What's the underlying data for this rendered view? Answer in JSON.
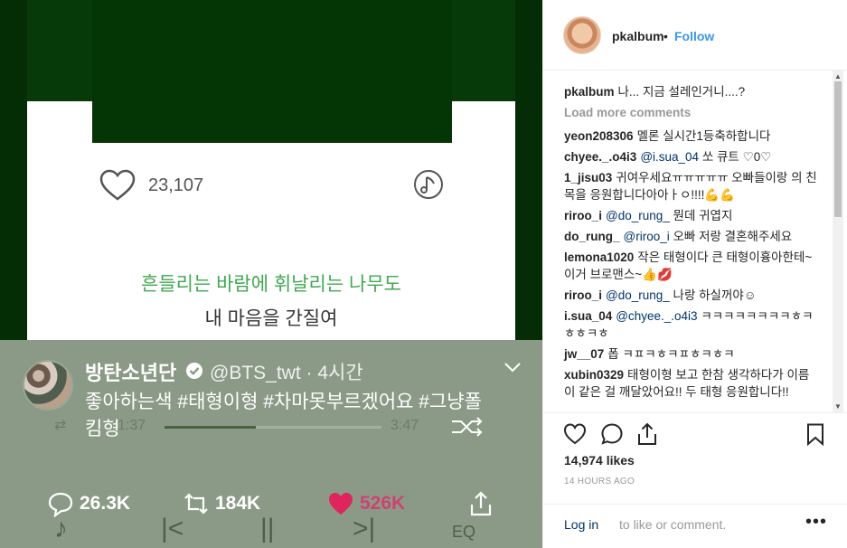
{
  "media": {
    "song": {
      "like_count": "23,107"
    },
    "lyrics": {
      "line1": "흔들리는 바람에 휘날리는 나무도",
      "line2": "내 마음을 간질여"
    },
    "tweet": {
      "name": "방탄소년단",
      "handle_time": "@BTS_twt · 4시간",
      "text_line1": "좋아하는색 #태형이형 #차마못부르겠어요 #그냥폴",
      "text_line2": "킴형",
      "time_start": "1:37",
      "time_end": "3:47",
      "progress_fraction": 0.42,
      "replies": "26.3K",
      "retweets": "184K",
      "likes": "526K",
      "like_color": "#e0245e"
    }
  },
  "post": {
    "username": "pkalbum",
    "separator": "•",
    "follow_label": "Follow",
    "caption": {
      "user": "pkalbum",
      "text": "나... 지금 설레인거니....?"
    },
    "load_more": "Load more comments",
    "comments": [
      {
        "user": "yeon208306",
        "mention": "",
        "text": "멜론 실시간1등축하합니다"
      },
      {
        "user": "chyee._.o4i3",
        "mention": "@i.sua_04",
        "text": "쏘 큐트 ♡0♡"
      },
      {
        "user": "1_jisu03",
        "mention": "",
        "text": "귀여우세요ㅠㅠㅠㅠㅠ 오빠들이랑 의 친목을 응원합니다아아ㅏㅇ!!!!💪💪"
      },
      {
        "user": "riroo_i",
        "mention": "@do_rung_",
        "text": "뭔데 귀엽지"
      },
      {
        "user": "do_rung_",
        "mention": "@riroo_i",
        "text": "오빠 저랑 결혼해주세요"
      },
      {
        "user": "lemona1020",
        "mention": "",
        "text": "작은 태형이다 큰 태형이흉아한테~ 이거 브로맨스~👍💋"
      },
      {
        "user": "riroo_i",
        "mention": "@do_rung_",
        "text": "나랑 하실꺼야☺"
      },
      {
        "user": "i.sua_04",
        "mention": "@chyee._.o4i3",
        "text": "ㅋㅋㅋㅋㅋㅋㅋㅋㅎㅋㅎㅎㅋㅎ"
      },
      {
        "user": "jw__07",
        "mention": "",
        "text": "폽 ㅋㅍㅋㅎㅋㅍㅎㅋㅎㅋ"
      },
      {
        "user": "xubin0329",
        "mention": "",
        "text": "태형이형 보고 한참 생각하다가 이름이 같은 걸 깨달았어요!! 두 태형 응원합니다!!"
      }
    ],
    "likes": "14,974 likes",
    "timestamp": "14 HOURS AGO",
    "login_link": "Log in",
    "login_rest": "to like or comment.",
    "more_label": "•••",
    "accent_color": "#3897f0"
  }
}
